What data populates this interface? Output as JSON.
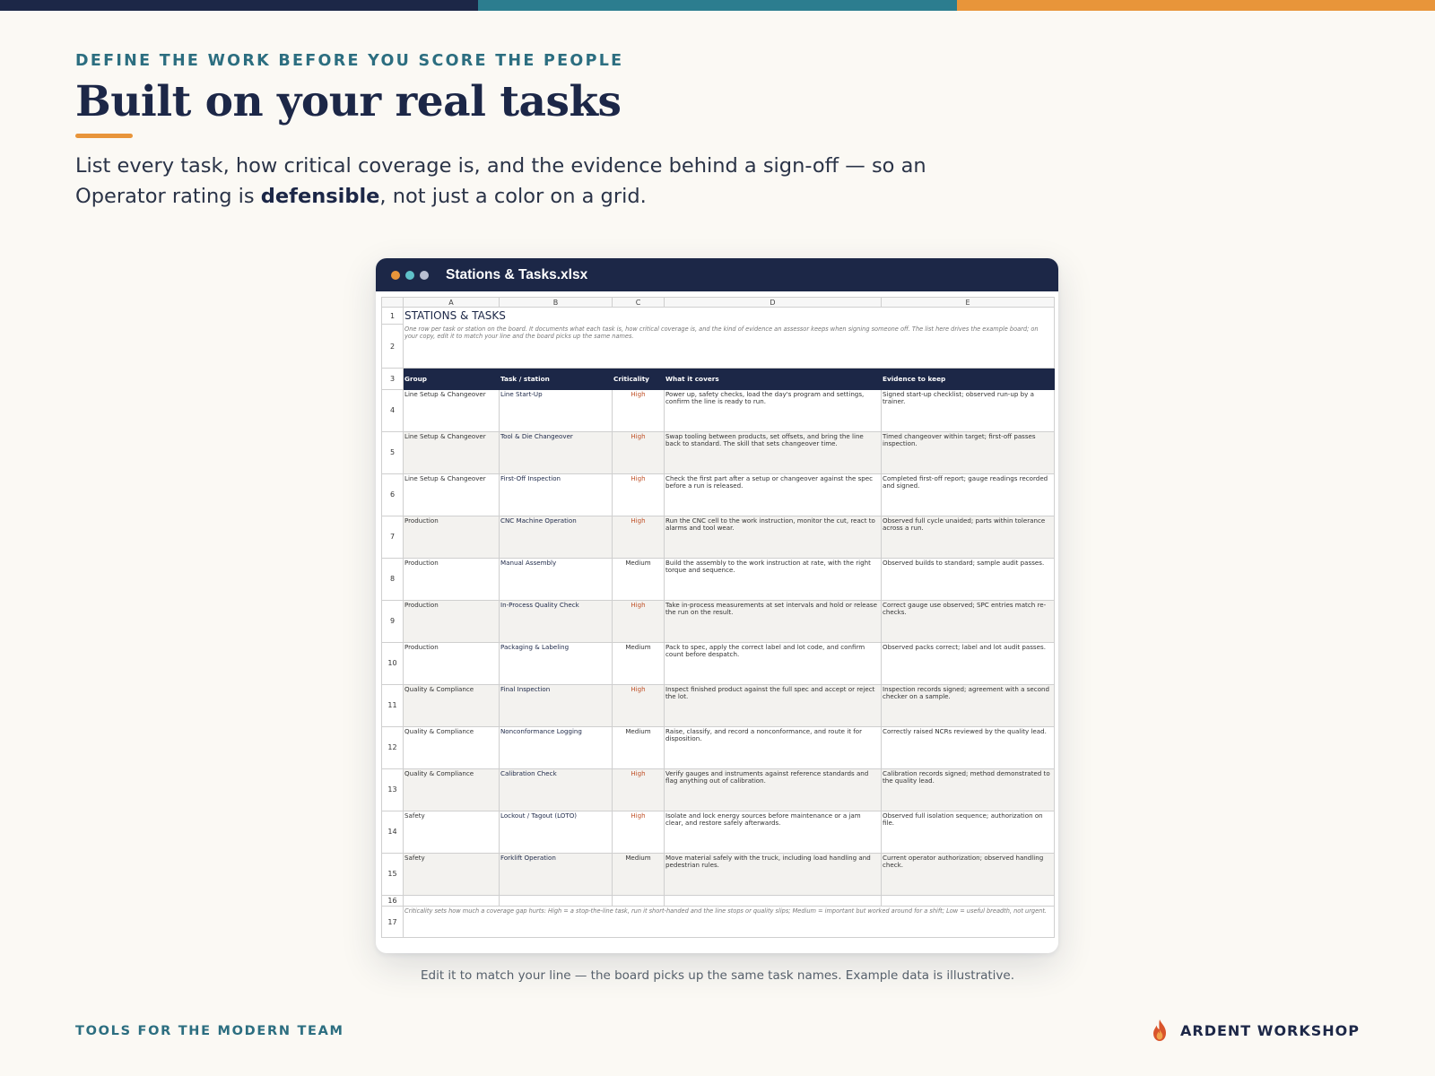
{
  "colors": {
    "navy": "#1c2747",
    "teal": "#2c7d8f",
    "orange": "#e8953a",
    "high": "#c0532a"
  },
  "top_bar_colors": [
    "#1c2747",
    "#2c7d8f",
    "#e8953a"
  ],
  "header": {
    "eyebrow": "DEFINE THE WORK BEFORE YOU SCORE THE PEOPLE",
    "title": "Built on your real tasks",
    "subtitle_before": "List every task, how critical coverage is, and the evidence behind a sign-off — so an Operator rating is ",
    "subtitle_bold": "defensible",
    "subtitle_after": ", not just a color on a grid."
  },
  "window": {
    "dots": [
      "#e8953a",
      "#5fc1c9",
      "#b9bfd1"
    ],
    "title": "Stations & Tasks.xlsx"
  },
  "sheet": {
    "column_letters": [
      "A",
      "B",
      "C",
      "D",
      "E"
    ],
    "title": "STATIONS & TASKS",
    "note": "One row per task or station on the board. It documents what each task is, how critical coverage is, and the kind of evidence an assessor keeps when signing someone off. The list here drives the example board; on your copy, edit it to match your line and the board picks up the same names.",
    "headers": [
      "Group",
      "Task / station",
      "Criticality",
      "What it covers",
      "Evidence to keep"
    ],
    "rows": [
      {
        "row": "4",
        "group": "Line Setup & Changeover",
        "task": "Line Start-Up",
        "criticality": "High",
        "covers": "Power up, safety checks, load the day's program and settings, confirm the line is ready to run.",
        "evidence": "Signed start-up checklist; observed run-up by a trainer."
      },
      {
        "row": "5",
        "group": "Line Setup & Changeover",
        "task": "Tool & Die Changeover",
        "criticality": "High",
        "covers": "Swap tooling between products, set offsets, and bring the line back to standard. The skill that sets changeover time.",
        "evidence": "Timed changeover within target; first-off passes inspection."
      },
      {
        "row": "6",
        "group": "Line Setup & Changeover",
        "task": "First-Off Inspection",
        "criticality": "High",
        "covers": "Check the first part after a setup or changeover against the spec before a run is released.",
        "evidence": "Completed first-off report; gauge readings recorded and signed."
      },
      {
        "row": "7",
        "group": "Production",
        "task": "CNC Machine Operation",
        "criticality": "High",
        "covers": "Run the CNC cell to the work instruction, monitor the cut, react to alarms and tool wear.",
        "evidence": "Observed full cycle unaided; parts within tolerance across a run."
      },
      {
        "row": "8",
        "group": "Production",
        "task": "Manual Assembly",
        "criticality": "Medium",
        "covers": "Build the assembly to the work instruction at rate, with the right torque and sequence.",
        "evidence": "Observed builds to standard; sample audit passes."
      },
      {
        "row": "9",
        "group": "Production",
        "task": "In-Process Quality Check",
        "criticality": "High",
        "covers": "Take in-process measurements at set intervals and hold or release the run on the result.",
        "evidence": "Correct gauge use observed; SPC entries match re-checks."
      },
      {
        "row": "10",
        "group": "Production",
        "task": "Packaging & Labeling",
        "criticality": "Medium",
        "covers": "Pack to spec, apply the correct label and lot code, and confirm count before despatch.",
        "evidence": "Observed packs correct; label and lot audit passes."
      },
      {
        "row": "11",
        "group": "Quality & Compliance",
        "task": "Final Inspection",
        "criticality": "High",
        "covers": "Inspect finished product against the full spec and accept or reject the lot.",
        "evidence": "Inspection records signed; agreement with a second checker on a sample."
      },
      {
        "row": "12",
        "group": "Quality & Compliance",
        "task": "Nonconformance Logging",
        "criticality": "Medium",
        "covers": "Raise, classify, and record a nonconformance, and route it for disposition.",
        "evidence": "Correctly raised NCRs reviewed by the quality lead."
      },
      {
        "row": "13",
        "group": "Quality & Compliance",
        "task": "Calibration Check",
        "criticality": "High",
        "covers": "Verify gauges and instruments against reference standards and flag anything out of calibration.",
        "evidence": "Calibration records signed; method demonstrated to the quality lead."
      },
      {
        "row": "14",
        "group": "Safety",
        "task": "Lockout / Tagout (LOTO)",
        "criticality": "High",
        "covers": "Isolate and lock energy sources before maintenance or a jam clear, and restore safely afterwards.",
        "evidence": "Observed full isolation sequence; authorization on file."
      },
      {
        "row": "15",
        "group": "Safety",
        "task": "Forklift Operation",
        "criticality": "Medium",
        "covers": "Move material safely with the truck, including load handling and pedestrian rules.",
        "evidence": "Current operator authorization; observed handling check."
      }
    ],
    "footnote": "Criticality sets how much a coverage gap hurts: High = a stop-the-line task, run it short-handed and the line stops or quality slips; Medium = important but worked around for a shift; Low = useful breadth, not urgent."
  },
  "caption": "Edit it to match your line — the board picks up the same task names. Example data is illustrative.",
  "footer": {
    "tagline": "TOOLS FOR THE MODERN TEAM",
    "logo_icon": "flame-icon",
    "brand": "ARDENT WORKSHOP"
  }
}
